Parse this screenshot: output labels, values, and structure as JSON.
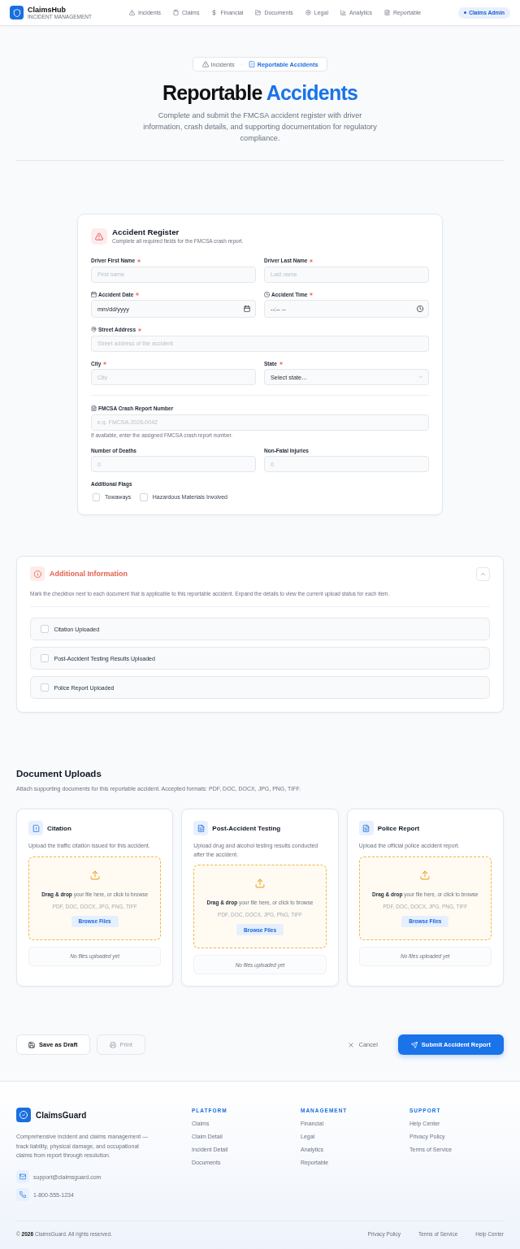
{
  "header": {
    "brand": "ClaimsHub",
    "tagline": "INCIDENT MANAGEMENT",
    "nav": [
      {
        "label": "Incidents",
        "selected": false
      },
      {
        "label": "Claims",
        "selected": false
      },
      {
        "label": "Financial",
        "selected": false
      },
      {
        "label": "Documents",
        "selected": false
      },
      {
        "label": "Legal",
        "selected": false
      },
      {
        "label": "Analytics",
        "selected": false
      },
      {
        "label": "Reportable",
        "selected": false
      }
    ],
    "user_badge": "Claims Admin"
  },
  "hero": {
    "breadcrumb": [
      {
        "label": "Incidents",
        "selected": false
      },
      {
        "label": "Reportable Accidents",
        "selected": true
      }
    ],
    "title_lead": "Reportable",
    "title_accent": "Accidents",
    "subtitle": "Complete and submit the FMCSA accident register with driver information, crash details, and supporting documentation for regulatory compliance."
  },
  "accident_register": {
    "title": "Accident Register",
    "subtitle": "Complete all required fields for the FMCSA crash report.",
    "groups": [
      {
        "rows": [
          [
            {
              "kind": "text",
              "label": "Driver First Name",
              "required": true,
              "placeholder": "First name"
            },
            {
              "kind": "text",
              "label": "Driver Last Name",
              "required": true,
              "placeholder": "Last name"
            }
          ],
          [
            {
              "kind": "date",
              "label": "Accident Date",
              "required": true,
              "placeholder": "mm/dd/yyyy"
            },
            {
              "kind": "time",
              "label": "Accident Time",
              "required": true,
              "placeholder": "--:-- --"
            }
          ],
          [
            {
              "kind": "address",
              "label": "Street Address",
              "required": true,
              "placeholder": "Street address of the accident"
            }
          ],
          [
            {
              "kind": "text",
              "label": "City",
              "required": true,
              "placeholder": "City"
            },
            {
              "kind": "select",
              "label": "State",
              "required": true,
              "placeholder": "Select state..."
            }
          ]
        ]
      },
      {
        "rows": [
          [
            {
              "kind": "document",
              "label": "FMCSA Crash Report Number",
              "required": false,
              "placeholder": "e.g. FMCSA-2026-0042",
              "hint": "If available, enter the assigned FMCSA crash report number."
            }
          ],
          [
            {
              "kind": "number",
              "label": "Number of Deaths",
              "required": false,
              "placeholder": "0"
            },
            {
              "kind": "number",
              "label": "Non-Fatal Injuries",
              "required": false,
              "placeholder": "0"
            }
          ]
        ]
      }
    ],
    "flags_label": "Additional Flags",
    "flags": [
      {
        "label": "Towaways",
        "checked": false
      },
      {
        "label": "Hazardous Materials Involved",
        "checked": false
      }
    ]
  },
  "additional_info": {
    "title": "Additional Information",
    "expanded": true,
    "description": "Mark the checkbox next to each document that is applicable to this reportable accident. Expand the details to view the current upload status for each item.",
    "items": [
      {
        "label": "Citation Uploaded",
        "checked": false
      },
      {
        "label": "Post-Accident Testing Results Uploaded",
        "checked": false
      },
      {
        "label": "Police Report Uploaded",
        "checked": false
      }
    ]
  },
  "uploads": {
    "title": "Document Uploads",
    "subtitle": "Attach supporting documents for this reportable accident. Accepted formats: PDF, DOC, DOCX, JPG, PNG, TIFF.",
    "cards": [
      {
        "kind": "citation",
        "title": "Citation",
        "description": "Upload the traffic citation issued for this accident.",
        "drop_text": "**Drag & drop** your file here, or click to browse",
        "formats": "PDF, DOC, DOCX, JPG, PNG, TIFF",
        "button": "Browse Files",
        "status": "No files uploaded yet"
      },
      {
        "kind": "testing",
        "title": "Post-Accident Testing",
        "description": "Upload drug and alcohol testing results conducted after the accident.",
        "drop_text": "**Drag & drop** your file here, or click to browse",
        "formats": "PDF, DOC, DOCX, JPG, PNG, TIFF",
        "button": "Browse Files",
        "status": "No files uploaded yet"
      },
      {
        "kind": "report",
        "title": "Police Report",
        "description": "Upload the official police accident report.",
        "drop_text": "**Drag & drop** your file here, or click to browse",
        "formats": "PDF, DOC, DOCX, JPG, PNG, TIFF",
        "button": "Browse Files",
        "status": "No files uploaded yet"
      }
    ]
  },
  "actions": {
    "left": [
      {
        "kind": "draft",
        "label": "Save as Draft"
      },
      {
        "kind": "print",
        "label": "Print"
      }
    ],
    "right": [
      {
        "kind": "cancel",
        "label": "Cancel"
      },
      {
        "kind": "submit",
        "label": "Submit Accident Report"
      }
    ]
  },
  "footer": {
    "brand": "ClaimsGuard",
    "description": "Comprehensive incident and claims management — track liability, physical damage, and occupational claims from report through resolution.",
    "contacts": [
      {
        "kind": "email",
        "text": "support@claimsguard.com"
      },
      {
        "kind": "phone",
        "text": "1-800-555-1234"
      }
    ],
    "columns": [
      {
        "heading": "PLATFORM",
        "links": [
          "Claims",
          "Claim Detail",
          "Incident Detail",
          "Documents"
        ]
      },
      {
        "heading": "MANAGEMENT",
        "links": [
          "Financial",
          "Legal",
          "Analytics",
          "Reportable"
        ]
      },
      {
        "heading": "SUPPORT",
        "links": [
          "Help Center",
          "Privacy Policy",
          "Terms of Service"
        ]
      }
    ],
    "copyright": "© **2026** ClaimsGuard. All rights reserved.",
    "legal_links": [
      "Privacy Policy",
      "Terms of Service",
      "Help Center"
    ]
  }
}
